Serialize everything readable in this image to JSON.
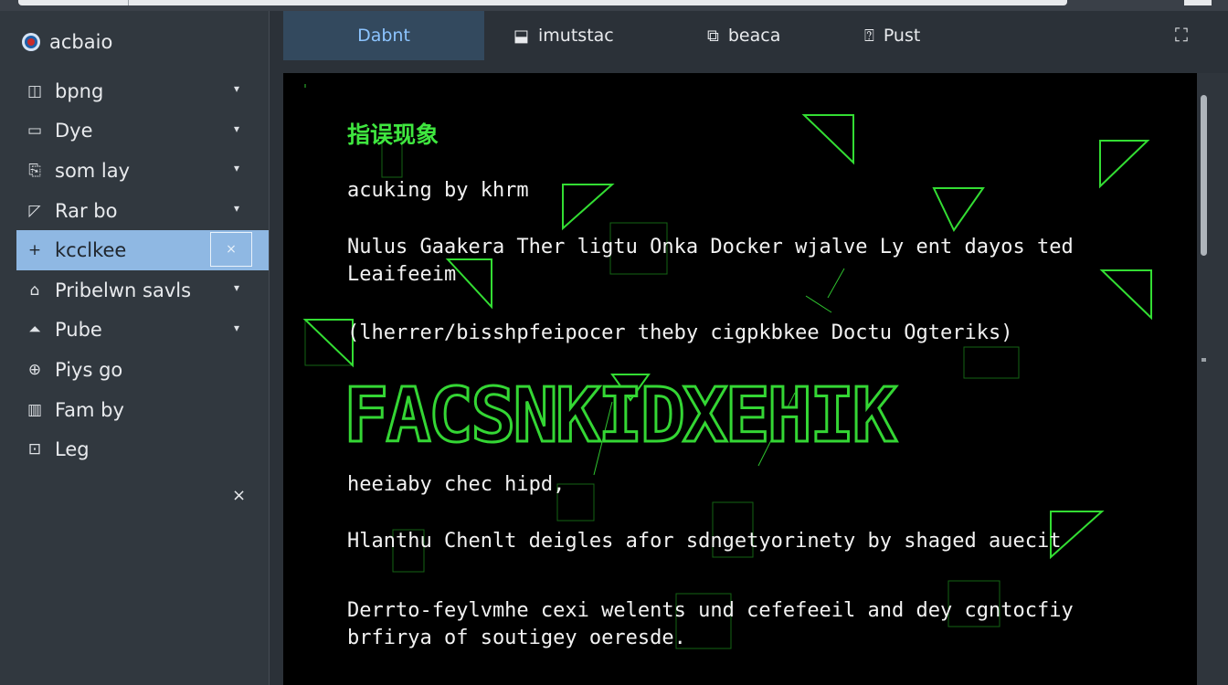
{
  "app": {
    "title": "acbaio"
  },
  "sidebar": {
    "items": [
      {
        "label": "bpng",
        "icon": "columns-icon",
        "glyph": "◫",
        "chevron": "▾"
      },
      {
        "label": "Dye",
        "icon": "card-icon",
        "glyph": "▭",
        "chevron": "▾"
      },
      {
        "label": "som lay",
        "icon": "file-icon",
        "glyph": "⎘",
        "chevron": "▾"
      },
      {
        "label": "Rar bo",
        "icon": "note-icon",
        "glyph": "◸",
        "chevron": "▾"
      },
      {
        "label": "kcclkee",
        "icon": "plus-icon",
        "glyph": "+",
        "close": "×",
        "active": true
      },
      {
        "label": "Pribelwn savls",
        "icon": "lock-icon",
        "glyph": "⌂",
        "chevron": "▾"
      },
      {
        "label": "Pube",
        "icon": "triangle-icon",
        "glyph": "⏶",
        "chevron": "▾"
      },
      {
        "label": "Piys go",
        "icon": "circle-icon",
        "glyph": "⊕",
        "chevron": ""
      },
      {
        "label": "Fam by",
        "icon": "grid-icon",
        "glyph": "▥",
        "chevron": ""
      },
      {
        "label": "Leg",
        "icon": "image-icon",
        "glyph": "⊡",
        "chevron": ""
      }
    ],
    "close_label": "×"
  },
  "tabs": [
    {
      "label": "Dabnt",
      "icon": "",
      "active": true
    },
    {
      "label": "imutstac",
      "icon": "folder-icon",
      "glyph": "⬓"
    },
    {
      "label": "beaca",
      "icon": "copy-icon",
      "glyph": "⧉"
    },
    {
      "label": "Pust",
      "icon": "document-icon",
      "glyph": "⍰"
    }
  ],
  "toolbar": {
    "expand_glyph": "⛶"
  },
  "terminal": {
    "heading": "指误现象",
    "lines": [
      "acuking by khrm",
      "Nulus Gaakera Ther ligtu Onka Docker wjalve Ly ent dayos ted",
      "Leaifeeim",
      "(lherrer/bisshpfeipocer theby cigpkbkee Doctu Ogteriks)",
      "heeiaby chec hipd,",
      "Hlanthu Chenlt deigles afor sdngetyorinety by shaged auecit",
      "Derrto-feylvmhe cexi welents und cefefeeil and dey cgntocfiy",
      "brfirya of soutigey oeresde."
    ],
    "banner": "FACSNKIDXEHIK"
  },
  "colors": {
    "accent": "#8cc4ff",
    "terminal_green": "#3fe63f",
    "active_item": "#8fb8e3",
    "sidebar_bg": "#31383f",
    "terminal_bg": "#000000"
  }
}
